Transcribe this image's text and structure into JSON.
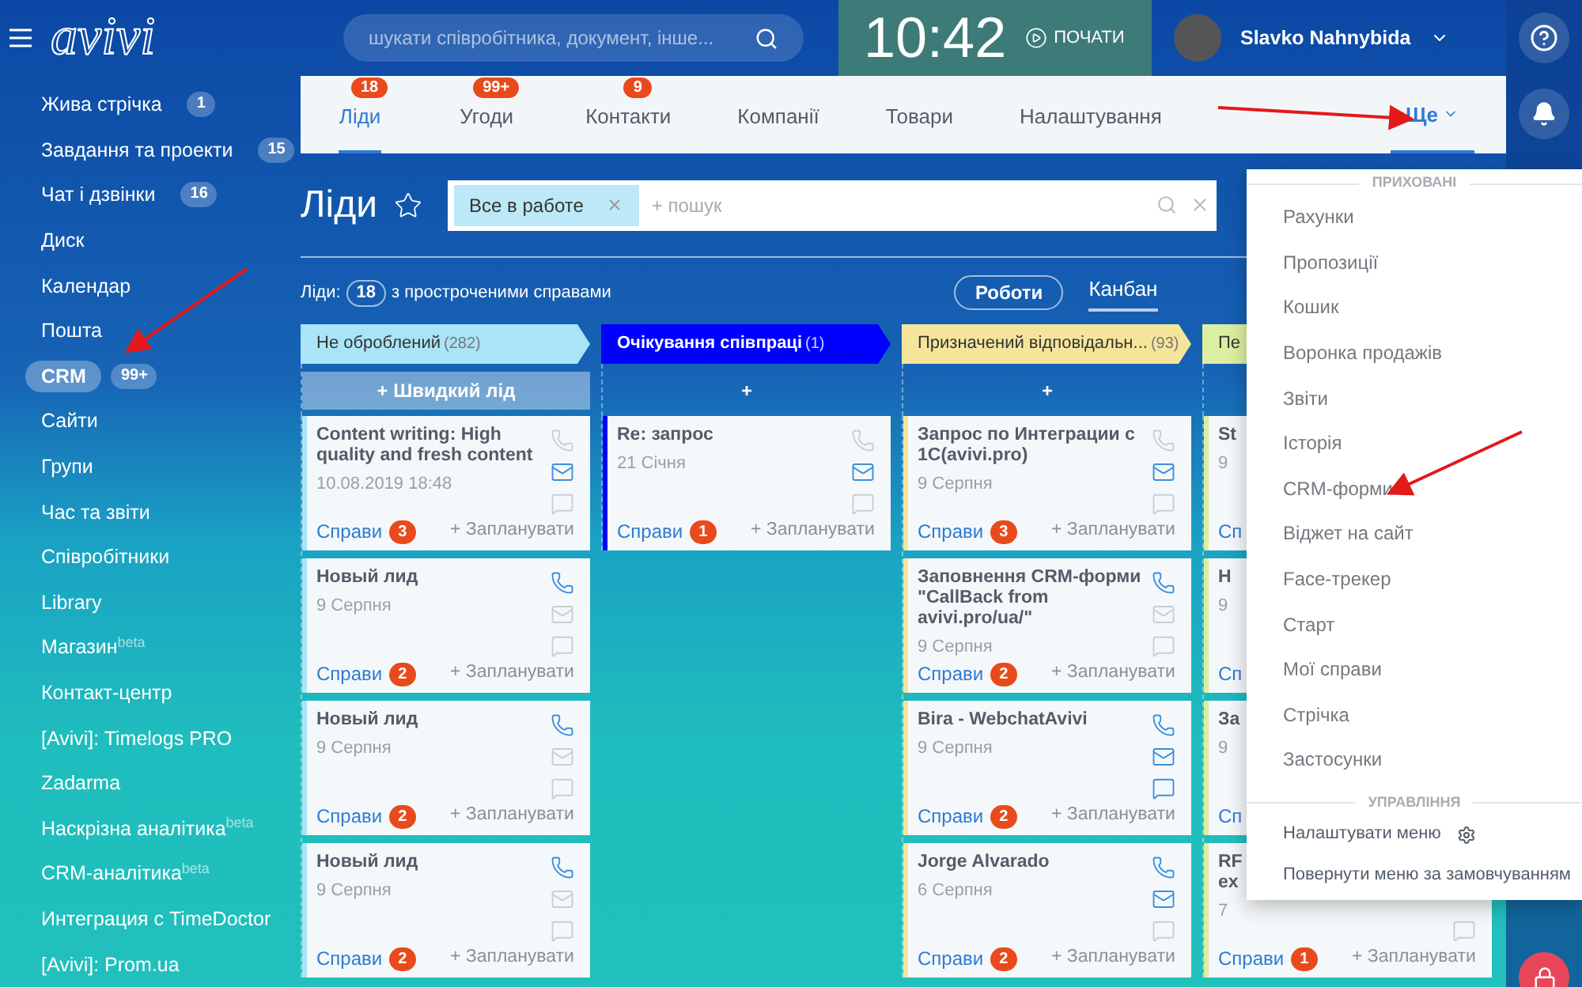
{
  "topbar": {
    "logo": "avivi",
    "search": {
      "placeholder": "шукати співробітника, документ, інше..."
    },
    "clock": {
      "time": "10:42",
      "action": "ПОЧАТИ"
    },
    "user": {
      "name": "Slavko Nahnybida"
    }
  },
  "sidebar": {
    "items": [
      {
        "label": "Жива стрічка",
        "badge": "1",
        "selected": false
      },
      {
        "label": "Завдання та проекти",
        "badge": "15",
        "selected": false
      },
      {
        "label": "Чат і дзвінки",
        "badge": "16",
        "selected": false
      },
      {
        "label": "Диск",
        "selected": false
      },
      {
        "label": "Календар",
        "selected": false
      },
      {
        "label": "Пошта",
        "selected": false
      },
      {
        "label": "CRM",
        "badge": "99+",
        "selected": true
      },
      {
        "label": "Сайти",
        "selected": false
      },
      {
        "label": "Групи",
        "selected": false
      },
      {
        "label": "Час та звіти",
        "selected": false
      },
      {
        "label": "Співробітники",
        "selected": false
      },
      {
        "label": "Library",
        "selected": false
      },
      {
        "label": "Магазин",
        "sup": "beta",
        "selected": false
      },
      {
        "label": "Контакт-центр",
        "selected": false
      },
      {
        "label": "[Avivi]: Timelogs PRO",
        "selected": false
      },
      {
        "label": "Zadarma",
        "selected": false
      },
      {
        "label": "Наскрізна аналітика",
        "sup": "beta",
        "selected": false
      },
      {
        "label": "CRM-аналітика",
        "sup": "beta",
        "selected": false
      },
      {
        "label": "Интеграция с TimeDoctor",
        "selected": false
      },
      {
        "label": "[Avivi]: Prom.ua",
        "selected": false
      }
    ]
  },
  "tabs": [
    {
      "label": "Ліди",
      "badge": "18",
      "selected": true
    },
    {
      "label": "Угоди",
      "badge": "99+",
      "selected": false
    },
    {
      "label": "Контакти",
      "badge": "9",
      "selected": false
    },
    {
      "label": "Компанії",
      "selected": false
    },
    {
      "label": "Товари",
      "selected": false
    },
    {
      "label": "Налаштування",
      "selected": false
    }
  ],
  "more_tab": {
    "label": "Ще",
    "open": true
  },
  "page": {
    "title": "Ліди",
    "filter": {
      "chip": "Все в работе",
      "placeholder": "+ пошук"
    },
    "summary": {
      "label": "Ліди:",
      "count": "18",
      "text": "з простроченими справами"
    },
    "filter_button": "Роботи",
    "view_tabs": [
      {
        "label": "Канбан",
        "selected": true
      }
    ]
  },
  "columns": [
    {
      "title": "Не оброблений",
      "count": "(282)",
      "color": "#a9e4f7",
      "add": "+ Швидкий лід",
      "cards": [
        {
          "title": "Content writing: High quality and fresh content",
          "date": "10.08.2019 18:48",
          "phone": false,
          "mail": true,
          "chat": false,
          "deals": "Справи",
          "deals_count": "3",
          "plan": "+ Запланувати"
        },
        {
          "title": "Новый лид",
          "date": "9 Серпня",
          "phone": true,
          "mail": false,
          "chat": false,
          "deals": "Справи",
          "deals_count": "2",
          "plan": "+ Запланувати"
        },
        {
          "title": "Новый лид",
          "date": "9 Серпня",
          "phone": true,
          "mail": false,
          "chat": false,
          "deals": "Справи",
          "deals_count": "2",
          "plan": "+ Запланувати"
        },
        {
          "title": "Новый лид",
          "date": "9 Серпня",
          "phone": true,
          "mail": false,
          "chat": false,
          "deals": "Справи",
          "deals_count": "2",
          "plan": "+ Запланувати"
        }
      ]
    },
    {
      "title": "Очікування співпраці",
      "count": "(1)",
      "color": "#0000ff",
      "add": "+",
      "cards": [
        {
          "title": "Re: запрос",
          "date": "21 Січня",
          "phone": false,
          "mail": true,
          "chat": false,
          "deals": "Справи",
          "deals_count": "1",
          "plan": "+ Запланувати"
        }
      ]
    },
    {
      "title": "Призначений відповідальн...",
      "count": "(93)",
      "color": "#f5e59b",
      "add": "+",
      "cards": [
        {
          "title": "Запрос по Интеграции с 1С(avivi.pro)",
          "date": "9 Серпня",
          "phone": false,
          "mail": true,
          "chat": false,
          "deals": "Справи",
          "deals_count": "3",
          "plan": "+ Запланувати"
        },
        {
          "title": "Заповнення CRM-форми \"CallBack from avivi.pro/ua/\"",
          "date": "9 Серпня",
          "phone": true,
          "mail": false,
          "chat": false,
          "deals": "Справи",
          "deals_count": "2",
          "plan": "+ Запланувати"
        },
        {
          "title": "Bira - WebchatAvivi",
          "date": "9 Серпня",
          "phone": true,
          "mail": true,
          "chat": true,
          "deals": "Справи",
          "deals_count": "2",
          "plan": "+ Запланувати"
        },
        {
          "title": "Jorge Alvarado",
          "date": "6 Серпня",
          "phone": true,
          "mail": true,
          "chat": false,
          "deals": "Справи",
          "deals_count": "2",
          "plan": "+ Запланувати"
        }
      ]
    },
    {
      "title": "Пе",
      "color": "#dcefa0",
      "cards": [
        {
          "title": "St",
          "date": "9",
          "deals": "Сп"
        },
        {
          "title": "Н",
          "date": "9",
          "deals": "Сп"
        },
        {
          "title": "За",
          "date": "9",
          "deals": "Сп"
        },
        {
          "title": "RF\nex",
          "date": "7",
          "chat": false,
          "deals": "Справи",
          "deals_count": "1",
          "plan": "+ Запланувати"
        }
      ]
    }
  ],
  "menu": {
    "sections": [
      {
        "title": "ПРИХОВАНІ",
        "items": [
          {
            "label": "Рахунки"
          },
          {
            "label": "Пропозиції"
          },
          {
            "label": "Кошик"
          },
          {
            "label": "Воронка продажів"
          },
          {
            "label": "Звіти"
          },
          {
            "label": "Історія"
          },
          {
            "label": "CRM-форми"
          },
          {
            "label": "Віджет на сайт"
          },
          {
            "label": "Face-трекер"
          },
          {
            "label": "Старт"
          },
          {
            "label": "Мої справи"
          },
          {
            "label": "Стрічка"
          },
          {
            "label": "Застосунки"
          }
        ]
      },
      {
        "title": "УПРАВЛІННЯ",
        "items": [
          {
            "label": "Налаштувати меню",
            "kind": "settings"
          },
          {
            "label": "Повернути меню за замовчуванням",
            "kind": "plain"
          }
        ]
      }
    ]
  }
}
